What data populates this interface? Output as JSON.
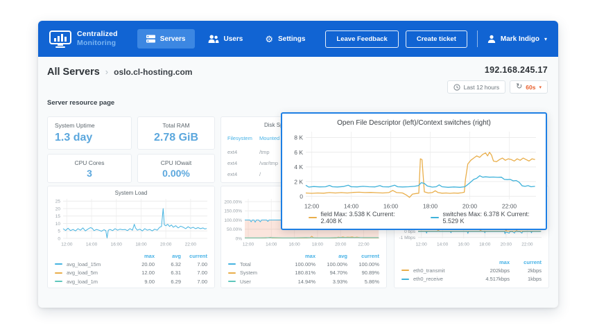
{
  "header": {
    "brand_line1": "Centralized",
    "brand_line2": "Monitoring",
    "nav": [
      {
        "label": "Servers",
        "active": true
      },
      {
        "label": "Users",
        "active": false
      },
      {
        "label": "Settings",
        "active": false
      }
    ],
    "feedback_button": "Leave Feedback",
    "create_ticket_button": "Create ticket",
    "user_name": "Mark Indigo"
  },
  "icons": {
    "gear": "⚙",
    "refresh": "↻",
    "caret": "▾",
    "breadcrumb_separator": "›"
  },
  "breadcrumb": {
    "root": "All Servers",
    "current": "oslo.cl-hosting.com"
  },
  "toolbar": {
    "server_ip": "192.168.245.17",
    "time_range_label": "Last 12 hours",
    "refresh_interval": "60s"
  },
  "page_label": "Server resource page",
  "stat_cards": [
    {
      "title": "System Uptime",
      "value": "1.3 day"
    },
    {
      "title": "Total RAM",
      "value": "2.78 GiB"
    },
    {
      "title": "CPU Cores",
      "value": "3"
    },
    {
      "title": "CPU IOwait",
      "value": "0.00%"
    }
  ],
  "disk_panel": {
    "title": "Disk Space",
    "headers": [
      "Filesystem",
      "Mounted on"
    ],
    "rows": [
      {
        "fs": "ext4",
        "mount": "/tmp"
      },
      {
        "fs": "ext4",
        "mount": "/var/tmp"
      },
      {
        "fs": "ext4",
        "mount": "/"
      }
    ]
  },
  "colors": {
    "header_blue": "#1164d3",
    "accent_blue": "#47b2e6",
    "value_blue": "#5ba7dd",
    "line_orange": "#e9ae4a",
    "line_blue": "#3fb2da",
    "line_teal": "#5fc6bc",
    "popup_border": "#1d7fe4",
    "refresh_orange": "#e85f2c"
  },
  "chart_data": [
    {
      "type": "line",
      "title": "Open File Descriptor (left)/Context switches (right)",
      "xlim": [
        11.7,
        23.35
      ],
      "ylim": [
        -0.45,
        8.8
      ],
      "xticks": [
        {
          "v": 12,
          "label": "12:00"
        },
        {
          "v": 14,
          "label": "14:00"
        },
        {
          "v": 16,
          "label": "16:00"
        },
        {
          "v": 18,
          "label": "18:00"
        },
        {
          "v": 20,
          "label": "20:00"
        },
        {
          "v": 22,
          "label": "22:00"
        }
      ],
      "yticks": [
        {
          "v": 0,
          "label": "0"
        },
        {
          "v": 2,
          "label": "2 K"
        },
        {
          "v": 4,
          "label": "4 K"
        },
        {
          "v": 6,
          "label": "6 K"
        },
        {
          "v": 8,
          "label": "8 K"
        }
      ],
      "series": [
        {
          "name": "field",
          "color": "#e9ae4a",
          "x": [
            11.7,
            12.0,
            12.3,
            12.6,
            12.9,
            13.2,
            13.5,
            13.8,
            14.1,
            14.4,
            14.7,
            15.0,
            15.3,
            15.6,
            15.9,
            16.1,
            16.3,
            16.6,
            16.8,
            16.95,
            17.1,
            17.3,
            17.42,
            17.5,
            17.58,
            17.7,
            17.9,
            18.1,
            18.25,
            18.4,
            18.6,
            18.8,
            19.0,
            19.2,
            19.4,
            19.6,
            19.72,
            19.78,
            19.9,
            20.05,
            20.2,
            20.35,
            20.5,
            20.65,
            20.8,
            20.9,
            21.0,
            21.1,
            21.2,
            21.35,
            21.5,
            21.65,
            21.8,
            21.95,
            22.1,
            22.25,
            22.4,
            22.55,
            22.7,
            22.85,
            23.0,
            23.15,
            23.3
          ],
          "values": [
            0.45,
            0.4,
            0.45,
            0.42,
            0.5,
            0.45,
            0.5,
            0.45,
            0.52,
            0.55,
            0.5,
            0.52,
            0.48,
            0.45,
            0.5,
            0.8,
            0.5,
            0.45,
            0.15,
            -0.15,
            0.3,
            0.38,
            0.42,
            5.1,
            5.0,
            0.6,
            0.45,
            0.5,
            0.75,
            0.5,
            0.42,
            0.45,
            0.4,
            0.45,
            0.42,
            0.48,
            0.55,
            2.3,
            4.4,
            4.9,
            5.2,
            5.5,
            5.3,
            5.7,
            5.9,
            5.5,
            6.0,
            5.6,
            4.8,
            4.7,
            5.0,
            5.2,
            4.9,
            5.1,
            5.0,
            4.8,
            5.1,
            4.9,
            5.2,
            5.0,
            4.8,
            5.1,
            5.0
          ]
        },
        {
          "name": "switches",
          "color": "#3fb2da",
          "x": [
            11.7,
            11.85,
            12.1,
            12.4,
            12.7,
            12.9,
            13.05,
            13.3,
            13.6,
            13.85,
            14.0,
            14.3,
            14.6,
            14.9,
            15.2,
            15.45,
            15.6,
            15.9,
            16.2,
            16.35,
            16.6,
            16.9,
            17.2,
            17.4,
            17.55,
            17.7,
            17.85,
            18.1,
            18.3,
            18.45,
            18.6,
            18.9,
            19.2,
            19.5,
            19.75,
            19.9,
            20.05,
            20.2,
            20.35,
            20.5,
            20.65,
            20.8,
            21.0,
            21.2,
            21.4,
            21.6,
            21.75,
            21.9,
            22.05,
            22.2,
            22.35,
            22.5,
            22.65,
            22.8,
            22.95,
            23.1,
            23.3
          ],
          "values": [
            1.5,
            1.25,
            1.32,
            1.28,
            1.3,
            1.48,
            1.3,
            1.27,
            1.32,
            1.5,
            1.3,
            1.28,
            1.35,
            1.3,
            1.28,
            1.45,
            1.3,
            1.28,
            1.5,
            1.3,
            1.27,
            1.3,
            1.35,
            1.45,
            1.85,
            1.75,
            1.4,
            1.25,
            1.3,
            1.55,
            1.3,
            1.22,
            1.27,
            1.22,
            1.3,
            1.6,
            1.95,
            2.3,
            2.45,
            2.8,
            2.6,
            2.65,
            2.6,
            2.62,
            2.58,
            2.6,
            2.3,
            2.27,
            2.3,
            2.1,
            2.15,
            1.9,
            1.42,
            1.35,
            1.45,
            1.3,
            1.35
          ]
        }
      ],
      "legend": [
        {
          "label": "field Max: 3.538 K Current: 2.408 K",
          "color": "#e9ae4a"
        },
        {
          "label": "switches Max: 6.378 K Current: 5.529 K",
          "color": "#3fb2da"
        }
      ]
    },
    {
      "type": "line",
      "title": "System Load",
      "xlim": [
        11.7,
        23.35
      ],
      "ylim": [
        0,
        26.5
      ],
      "xticks": [
        {
          "v": 12,
          "label": "12:00"
        },
        {
          "v": 14,
          "label": "14:00"
        },
        {
          "v": 16,
          "label": "16:00"
        },
        {
          "v": 18,
          "label": "18:00"
        },
        {
          "v": 20,
          "label": "20:00"
        },
        {
          "v": 22,
          "label": "22:00"
        }
      ],
      "yticks": [
        {
          "v": 0,
          "label": "0"
        },
        {
          "v": 5,
          "label": "5"
        },
        {
          "v": 10,
          "label": "10"
        },
        {
          "v": 15,
          "label": "15"
        },
        {
          "v": 20,
          "label": "20"
        },
        {
          "v": 25,
          "label": "25"
        }
      ],
      "series": [
        {
          "name": "avg_load_15m",
          "color": "#45b3e0",
          "x": [
            11.7,
            11.9,
            12.1,
            12.3,
            12.5,
            12.7,
            12.9,
            13.1,
            13.3,
            13.5,
            13.7,
            13.9,
            14.05,
            14.2,
            14.4,
            14.6,
            14.8,
            15.0,
            15.15,
            15.25,
            15.35,
            15.5,
            15.7,
            15.9,
            16.1,
            16.3,
            16.5,
            16.7,
            16.9,
            17.1,
            17.3,
            17.45,
            17.55,
            17.7,
            17.9,
            18.1,
            18.3,
            18.5,
            18.7,
            18.9,
            19.1,
            19.3,
            19.5,
            19.65,
            19.78,
            19.88,
            20.0,
            20.15,
            20.3,
            20.45,
            20.6,
            20.8,
            21.0,
            21.2,
            21.4,
            21.6,
            21.8,
            22.0,
            22.2,
            22.4,
            22.6,
            22.8,
            23.0,
            23.15,
            23.3
          ],
          "values": [
            6.5,
            5.3,
            6.8,
            5.2,
            6.0,
            5.0,
            6.5,
            5.5,
            7.0,
            5.0,
            6.2,
            7.2,
            6.8,
            5.2,
            6.0,
            5.5,
            4.8,
            5.8,
            5.2,
            0.3,
            5.5,
            6.0,
            5.2,
            6.5,
            5.5,
            6.2,
            5.8,
            6.0,
            5.2,
            6.5,
            5.5,
            9.5,
            7.0,
            5.5,
            6.2,
            5.0,
            6.5,
            5.5,
            6.0,
            5.0,
            6.2,
            5.5,
            7.5,
            8.0,
            20.0,
            9.0,
            8.5,
            9.5,
            8.0,
            9.0,
            7.5,
            8.5,
            7.0,
            8.2,
            7.5,
            6.5,
            7.8,
            6.8,
            7.5,
            6.5,
            7.2,
            6.5,
            7.0,
            6.3,
            6.6
          ]
        }
      ],
      "legend": {
        "headers": [
          "max",
          "avg",
          "current"
        ],
        "rows": [
          {
            "name": "avg_load_15m",
            "color": "#45b3e0",
            "max": "20.00",
            "avg": "6.32",
            "current": "7.00"
          },
          {
            "name": "avg_load_5m",
            "color": "#e9ae4a",
            "max": "12.00",
            "avg": "6.31",
            "current": "7.00"
          },
          {
            "name": "avg_load_1m",
            "color": "#5fc6bc",
            "max": "9.00",
            "avg": "6.29",
            "current": "7.00"
          }
        ]
      }
    },
    {
      "type": "area",
      "title": "",
      "xlim": [
        11.7,
        23.35
      ],
      "ylim": [
        0,
        215
      ],
      "xticks": [
        {
          "v": 12,
          "label": "12:00"
        },
        {
          "v": 14,
          "label": "14:00"
        },
        {
          "v": 16,
          "label": "16:00"
        },
        {
          "v": 18,
          "label": "18:00"
        },
        {
          "v": 20,
          "label": "20:00"
        },
        {
          "v": 22,
          "label": "22:00"
        }
      ],
      "yticks": [
        {
          "v": 0,
          "label": "0%"
        },
        {
          "v": 50,
          "label": "50.00%"
        },
        {
          "v": 100,
          "label": "100.00%"
        },
        {
          "v": 150,
          "label": "150.00%"
        },
        {
          "v": 200,
          "label": "200.00%"
        }
      ],
      "series": [
        {
          "name": "Total",
          "color": "#45b3e0",
          "fill": "rgba(240,150,120,0.25)",
          "x": [
            11.7,
            12.15,
            12.25,
            12.35,
            12.5,
            12.6,
            12.7,
            12.9,
            13.05,
            13.15,
            13.3,
            13.6,
            13.7,
            13.8,
            14.0,
            14.5,
            15.0,
            15.1,
            15.2,
            15.3,
            15.5,
            16.0,
            17.0,
            18.0,
            19.0,
            20.0,
            21.0,
            22.0,
            23.0,
            23.3
          ],
          "values": [
            100,
            100,
            90,
            100,
            100,
            88,
            100,
            100,
            90,
            100,
            100,
            100,
            92,
            100,
            100,
            100,
            100,
            100,
            200,
            100,
            100,
            100,
            100,
            100,
            100,
            100,
            100,
            100,
            100,
            100
          ]
        },
        {
          "name": "System",
          "color": "#e9ae4a",
          "x": [
            11.7,
            12.5,
            13.5,
            13.95,
            14.05,
            14.15,
            15.0,
            16.0,
            17.0,
            17.35,
            17.5,
            17.65,
            18.0,
            18.5,
            19.0,
            19.6,
            19.8,
            20.0,
            20.2,
            20.4,
            20.6,
            20.8,
            21.0,
            21.2,
            21.4,
            21.7,
            22.0,
            22.5,
            23.0,
            23.3
          ],
          "values": [
            2,
            2,
            2,
            6,
            2,
            2,
            2,
            2,
            2,
            3,
            12,
            3,
            2,
            2,
            2,
            2,
            7,
            5,
            8,
            5,
            7,
            6,
            8,
            5,
            7,
            4,
            3,
            3,
            3,
            3
          ]
        },
        {
          "name": "User",
          "color": "#5fc6bc",
          "x": [
            11.7,
            13.0,
            14.0,
            15.0,
            16.0,
            17.0,
            18.0,
            19.0,
            20.0,
            21.0,
            22.0,
            23.0,
            23.3
          ],
          "values": [
            3,
            3,
            4,
            3,
            3,
            4,
            3,
            3,
            5,
            4,
            4,
            4,
            4
          ]
        }
      ],
      "legend": {
        "headers": [
          "max",
          "avg",
          "current"
        ],
        "rows": [
          {
            "name": "Total",
            "color": "#45b3e0",
            "max": "100.00%",
            "avg": "100.00%",
            "current": "100.00%"
          },
          {
            "name": "System",
            "color": "#e9ae4a",
            "max": "180.81%",
            "avg": "94.70%",
            "current": "90.89%"
          },
          {
            "name": "User",
            "color": "#5fc6bc",
            "max": "14.94%",
            "avg": "3.93%",
            "current": "5.86%"
          }
        ]
      }
    },
    {
      "type": "line",
      "title": "",
      "xlim": [
        11.7,
        23.35
      ],
      "ylim": [
        -1.15,
        5.2
      ],
      "xticks": [
        {
          "v": 12,
          "label": "12:00"
        },
        {
          "v": 14,
          "label": "14:00"
        },
        {
          "v": 16,
          "label": "16:00"
        },
        {
          "v": 18,
          "label": "18:00"
        },
        {
          "v": 20,
          "label": "20:00"
        },
        {
          "v": 22,
          "label": "22:00"
        }
      ],
      "yticks": [
        {
          "v": 0,
          "label": "0 bps"
        },
        {
          "v": -1,
          "label": "-1 Mbps"
        }
      ],
      "series": [
        {
          "name": "eth0_transmit",
          "color": "#e9ae4a",
          "x": [
            11.7,
            12.5,
            13.55,
            13.6,
            13.65,
            14.5,
            15.5,
            16.5,
            17.55,
            17.6,
            17.65,
            18.5,
            19.5,
            19.9,
            20.0,
            20.1,
            20.5,
            20.9,
            21.0,
            21.1,
            21.5,
            22.0,
            22.5,
            23.0,
            23.3
          ],
          "values": [
            0.02,
            0.02,
            0.02,
            4.8,
            0.02,
            0.02,
            0.02,
            0.02,
            0.02,
            4.9,
            0.02,
            0.02,
            0.02,
            0.02,
            0.15,
            0.02,
            0.02,
            0.02,
            0.12,
            0.02,
            0.02,
            0.02,
            0.02,
            0.02,
            0.02
          ]
        },
        {
          "name": "eth0_receive",
          "color": "#3fb2da",
          "x": [
            11.7,
            12.2,
            12.45,
            12.5,
            12.55,
            13.2,
            14.0,
            14.75,
            14.8,
            14.85,
            15.5,
            16.35,
            16.4,
            16.45,
            17.2,
            17.95,
            18.0,
            18.05,
            18.8,
            19.4,
            19.85,
            19.9,
            19.95,
            20.3,
            20.35,
            20.6,
            20.8,
            20.85,
            21.3,
            21.5,
            21.55,
            22.0,
            22.35,
            22.4,
            22.45,
            23.0,
            23.3
          ],
          "values": [
            -0.05,
            -0.05,
            -0.05,
            -0.3,
            -0.05,
            -0.05,
            -0.05,
            -0.05,
            -0.25,
            -0.05,
            -0.05,
            -0.05,
            -0.35,
            -0.05,
            -0.05,
            -0.05,
            -0.25,
            -0.05,
            -0.05,
            -0.05,
            -0.05,
            -0.4,
            -0.1,
            -0.3,
            -0.08,
            -0.05,
            -0.3,
            -0.08,
            -0.05,
            -0.3,
            -0.06,
            -0.05,
            -0.05,
            -0.25,
            -0.05,
            -0.05,
            -0.05
          ]
        }
      ],
      "legend": {
        "headers": [
          "max",
          "current"
        ],
        "rows": [
          {
            "name": "eth0_transmit",
            "color": "#e9ae4a",
            "max": "202kbps",
            "current": "2kbps"
          },
          {
            "name": "eth0_receive",
            "color": "#3fb2da",
            "max": "4.517kbps",
            "current": "1kbps"
          }
        ]
      }
    }
  ]
}
